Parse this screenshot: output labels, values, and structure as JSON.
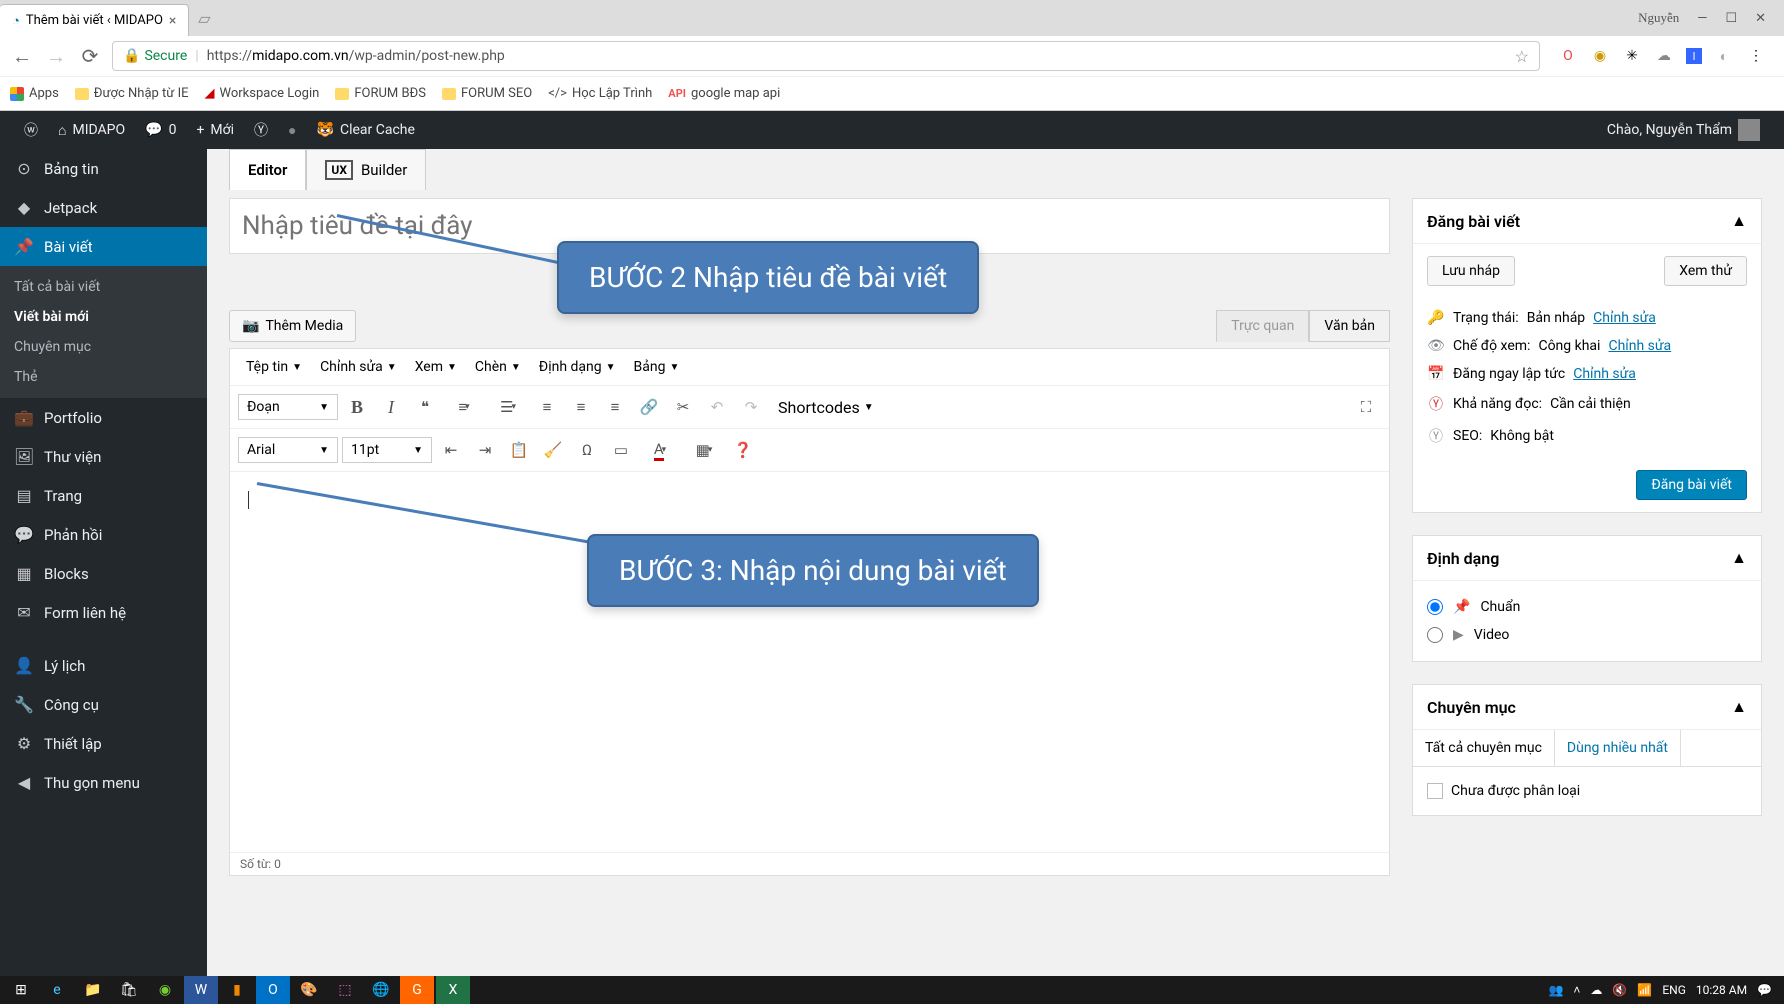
{
  "browser": {
    "tab_title": "Thêm bài viết ‹ MIDAPO",
    "user_hint": "Nguyễn",
    "secure": "Secure",
    "url_prefix": "https://",
    "url_domain": "midapo.com.vn",
    "url_path": "/wp-admin/post-new.php",
    "bookmarks": {
      "apps": "Apps",
      "b1": "Được Nhập từ IE",
      "b2": "Workspace Login",
      "b3": "FORUM BĐS",
      "b4": "FORUM SEO",
      "b5": "Học Lập Trình",
      "b6_prefix": "API",
      "b6": "google map api"
    }
  },
  "adminbar": {
    "site": "MIDAPO",
    "comments": "0",
    "new": "Mới",
    "clear_cache": "Clear Cache",
    "greeting": "Chào, Nguyễn Thẩm"
  },
  "sidebar": {
    "dashboard": "Bảng tin",
    "jetpack": "Jetpack",
    "posts": "Bài viết",
    "sub_all": "Tất cả bài viết",
    "sub_new": "Viết bài mới",
    "sub_cat": "Chuyên mục",
    "sub_tag": "Thẻ",
    "portfolio": "Portfolio",
    "media": "Thư viện",
    "pages": "Trang",
    "comments": "Phản hồi",
    "blocks": "Blocks",
    "forms": "Form liên hệ",
    "profile": "Lý lịch",
    "tools": "Công cụ",
    "settings": "Thiết lập",
    "collapse": "Thu gọn menu"
  },
  "editor": {
    "tab_editor": "Editor",
    "tab_ux": "UX",
    "tab_builder": "Builder",
    "title_placeholder": "Nhập tiêu đề tại đây",
    "add_media": "Thêm Media",
    "visual_tab": "Trực quan",
    "text_tab": "Văn bản",
    "menus": {
      "file": "Tệp tin",
      "edit": "Chỉnh sửa",
      "view": "Xem",
      "insert": "Chèn",
      "format": "Định dạng",
      "table": "Bảng"
    },
    "format_select": "Đoạn",
    "shortcodes": "Shortcodes",
    "font_select": "Arial",
    "size_select": "11pt",
    "word_count": "Số từ: 0"
  },
  "publish": {
    "title": "Đăng bài viết",
    "save_draft": "Lưu nháp",
    "preview": "Xem thử",
    "status_label": "Trạng thái:",
    "status_value": "Bản nháp",
    "visibility_label": "Chế độ xem:",
    "visibility_value": "Công khai",
    "schedule_label": "Đăng ngay lập tức",
    "readability_label": "Khả năng đọc:",
    "readability_value": "Cần cải thiện",
    "seo_label": "SEO:",
    "seo_value": "Không bật",
    "edit": "Chỉnh sửa",
    "publish_btn": "Đăng bài viết"
  },
  "format": {
    "title": "Định dạng",
    "standard": "Chuẩn",
    "video": "Video"
  },
  "categories": {
    "title": "Chuyên mục",
    "tab_all": "Tất cả chuyên mục",
    "tab_most": "Dùng nhiều nhất",
    "uncategorized": "Chưa được phân loại"
  },
  "callouts": {
    "step2": "BƯỚC 2 Nhập tiêu đề bài viết",
    "step3": "BƯỚC 3: Nhập nội dung bài viết"
  },
  "taskbar": {
    "lang": "ENG",
    "time": "10:28 AM"
  }
}
